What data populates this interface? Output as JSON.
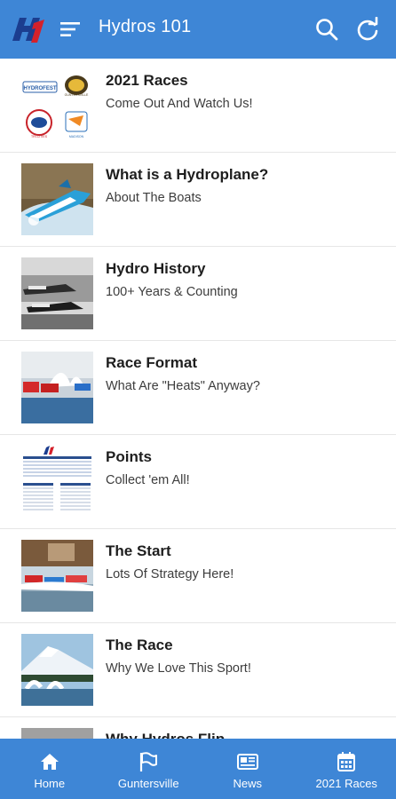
{
  "app": {
    "title": "Hydros 101",
    "logo_text": "H1",
    "colors": {
      "primary": "#3e86d6",
      "logo_red": "#d4212b",
      "logo_blue": "#1b3d8f"
    }
  },
  "header": {
    "menu_icon": "menu-icon",
    "search_icon": "search-icon",
    "refresh_icon": "refresh-icon"
  },
  "items": [
    {
      "title": "2021 Races",
      "subtitle": "Come Out And Watch Us!",
      "thumb": "race-logos",
      "thumb_text": [
        "HYDROFEST",
        "GUNTERSVILLE",
        "TRI-CITIES",
        "MADISON"
      ]
    },
    {
      "title": "What is a Hydroplane?",
      "subtitle": "About The Boats",
      "thumb": "blue-boat-photo"
    },
    {
      "title": "Hydro History",
      "subtitle": "100+ Years & Counting",
      "thumb": "vintage-photo"
    },
    {
      "title": "Race Format",
      "subtitle": "What Are \"Heats\" Anyway?",
      "thumb": "race-photo"
    },
    {
      "title": "Points",
      "subtitle": "Collect 'em All!",
      "thumb": "points-table"
    },
    {
      "title": "The Start",
      "subtitle": "Lots Of Strategy Here!",
      "thumb": "start-photo"
    },
    {
      "title": "The Race",
      "subtitle": "Why We Love This Sport!",
      "thumb": "mountain-photo"
    },
    {
      "title": "Why Hydros Flip",
      "subtitle": "",
      "thumb": "flip-photo"
    }
  ],
  "bottom_nav": [
    {
      "label": "Home",
      "icon": "home-icon"
    },
    {
      "label": "Guntersville",
      "icon": "flag-icon"
    },
    {
      "label": "News",
      "icon": "newspaper-icon"
    },
    {
      "label": "2021 Races",
      "icon": "calendar-icon"
    }
  ]
}
